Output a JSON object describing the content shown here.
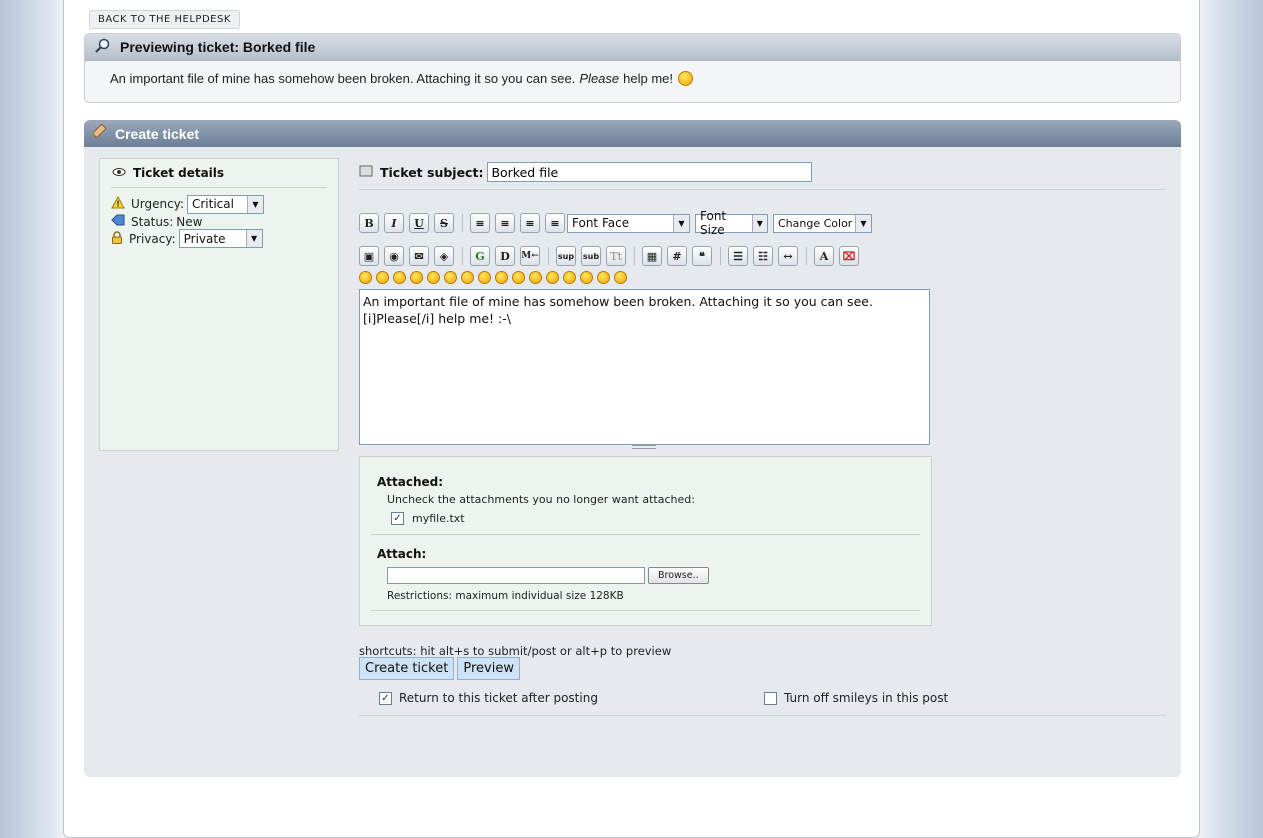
{
  "nav": {
    "back_label": "BACK TO THE HELPDESK"
  },
  "preview": {
    "title": "Previewing ticket: Borked file",
    "text_before": "An important file of mine has somehow been broken. Attaching it so you can see.",
    "text_italic": "Please",
    "text_after": "help me!"
  },
  "create": {
    "title": "Create ticket",
    "details": {
      "heading": "Ticket details",
      "urgency_label": "Urgency:",
      "urgency_value": "Critical",
      "status_label": "Status:",
      "status_value": "New",
      "privacy_label": "Privacy:",
      "privacy_value": "Private"
    },
    "subject_label": "Ticket subject:",
    "subject_value": "Borked file",
    "toolbar": {
      "font_face": "Font Face",
      "font_size": "Font Size",
      "change_color": "Change Color"
    },
    "body_text": "An important file of mine has somehow been broken. Attaching it so you can see.\n[i]Please[/i] help me! :-\\",
    "attachments": {
      "attached_heading": "Attached:",
      "uncheck_note": "Uncheck the attachments you no longer want attached:",
      "file_name": "myfile.txt",
      "attach_heading": "Attach:",
      "browse_label": "Browse..",
      "restrictions": "Restrictions: maximum individual size 128KB"
    },
    "shortcuts": "shortcuts: hit alt+s to submit/post or alt+p to preview",
    "submit_label": "Create ticket",
    "preview_label": "Preview",
    "option_return": "Return to this ticket after posting",
    "option_return_checked": true,
    "option_smileys": "Turn off smileys in this post",
    "option_smileys_checked": false
  },
  "colors": {
    "accent_header": "#7a8ba3",
    "panel_green": "#edf4ee",
    "button_blue": "#cde3f5"
  }
}
